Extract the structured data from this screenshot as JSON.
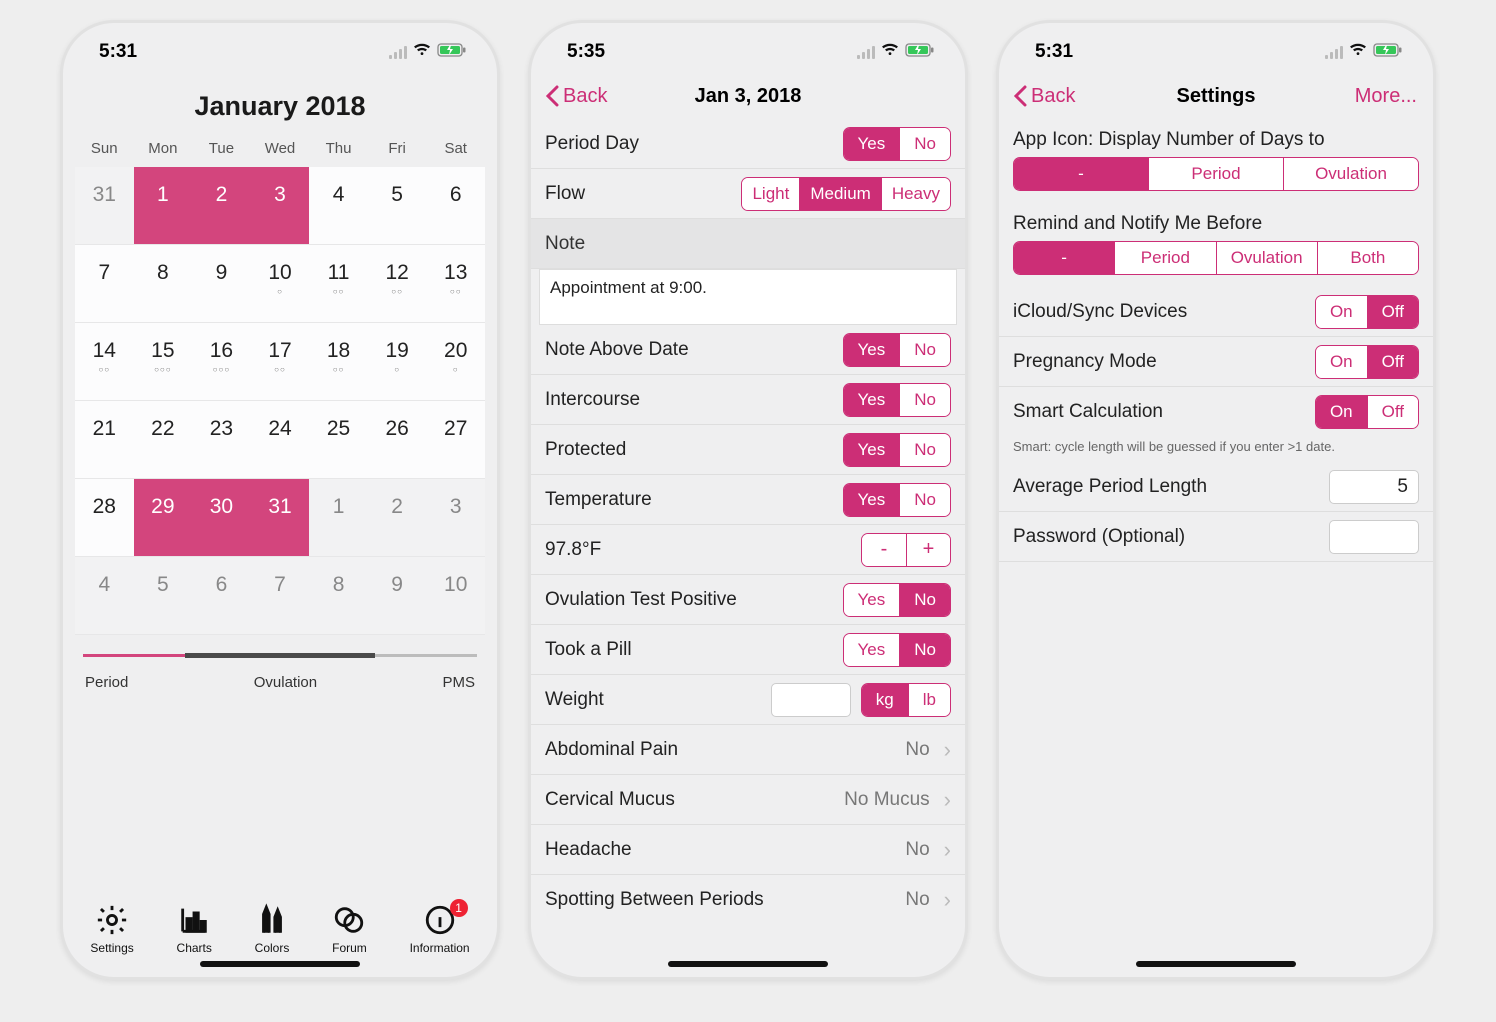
{
  "accent": "#cc2e76",
  "phone1": {
    "time": "5:31",
    "title": "January 2018",
    "dow": [
      "Sun",
      "Mon",
      "Tue",
      "Wed",
      "Thu",
      "Fri",
      "Sat"
    ],
    "cells": [
      {
        "n": "31",
        "dim": true
      },
      {
        "n": "1",
        "period": true
      },
      {
        "n": "2",
        "period": true
      },
      {
        "n": "3",
        "period": true
      },
      {
        "n": "4"
      },
      {
        "n": "5"
      },
      {
        "n": "6"
      },
      {
        "n": "7"
      },
      {
        "n": "8"
      },
      {
        "n": "9"
      },
      {
        "n": "10",
        "dots": "○"
      },
      {
        "n": "11",
        "dots": "○○"
      },
      {
        "n": "12",
        "dots": "○○"
      },
      {
        "n": "13",
        "dots": "○○"
      },
      {
        "n": "14",
        "dots": "○○"
      },
      {
        "n": "15",
        "dots": "○○○"
      },
      {
        "n": "16",
        "dots": "○○○"
      },
      {
        "n": "17",
        "dots": "○○"
      },
      {
        "n": "18",
        "dots": "○○"
      },
      {
        "n": "19",
        "dots": "○"
      },
      {
        "n": "20",
        "dots": "○"
      },
      {
        "n": "21"
      },
      {
        "n": "22"
      },
      {
        "n": "23"
      },
      {
        "n": "24"
      },
      {
        "n": "25"
      },
      {
        "n": "26"
      },
      {
        "n": "27"
      },
      {
        "n": "28"
      },
      {
        "n": "29",
        "period": true
      },
      {
        "n": "30",
        "period": true
      },
      {
        "n": "31",
        "period": true
      },
      {
        "n": "1",
        "dim": true
      },
      {
        "n": "2",
        "dim": true
      },
      {
        "n": "3",
        "dim": true
      },
      {
        "n": "4",
        "dim": true
      },
      {
        "n": "5",
        "dim": true
      },
      {
        "n": "6",
        "dim": true
      },
      {
        "n": "7",
        "dim": true
      },
      {
        "n": "8",
        "dim": true
      },
      {
        "n": "9",
        "dim": true
      },
      {
        "n": "10",
        "dim": true
      }
    ],
    "legend": {
      "period": "Period",
      "ovulation": "Ovulation",
      "pms": "PMS"
    },
    "tabs": {
      "settings": "Settings",
      "charts": "Charts",
      "colors": "Colors",
      "forum": "Forum",
      "info": "Information",
      "badge": "1"
    }
  },
  "phone2": {
    "time": "5:35",
    "back": "Back",
    "title": "Jan 3, 2018",
    "rows": {
      "period_day": "Period Day",
      "flow": "Flow",
      "note": "Note",
      "note_text": "Appointment at 9:00.",
      "note_above": "Note Above Date",
      "intercourse": "Intercourse",
      "protected": "Protected",
      "temperature": "Temperature",
      "temp_value": "97.8°F",
      "ovu_test": "Ovulation Test Positive",
      "pill": "Took a Pill",
      "weight": "Weight",
      "abdominal": "Abdominal Pain",
      "abdominal_v": "No",
      "mucus": "Cervical Mucus",
      "mucus_v": "No Mucus",
      "headache": "Headache",
      "headache_v": "No",
      "spotting": "Spotting Between Periods",
      "spotting_v": "No"
    },
    "opts": {
      "yes": "Yes",
      "no": "No",
      "light": "Light",
      "medium": "Medium",
      "heavy": "Heavy",
      "minus": "-",
      "plus": "+",
      "kg": "kg",
      "lb": "lb"
    }
  },
  "phone3": {
    "time": "5:31",
    "back": "Back",
    "title": "Settings",
    "more": "More...",
    "appicon_label": "App Icon: Display Number of Days to",
    "appicon_opts": [
      "-",
      "Period",
      "Ovulation"
    ],
    "remind_label": "Remind and Notify Me Before",
    "remind_opts": [
      "-",
      "Period",
      "Ovulation",
      "Both"
    ],
    "icloud": "iCloud/Sync Devices",
    "preg": "Pregnancy Mode",
    "smart": "Smart Calculation",
    "smart_note": "Smart: cycle length will be guessed if you enter >1 date.",
    "avg": "Average Period Length",
    "avg_val": "5",
    "pwd": "Password (Optional)",
    "onoff": {
      "on": "On",
      "off": "Off"
    }
  }
}
